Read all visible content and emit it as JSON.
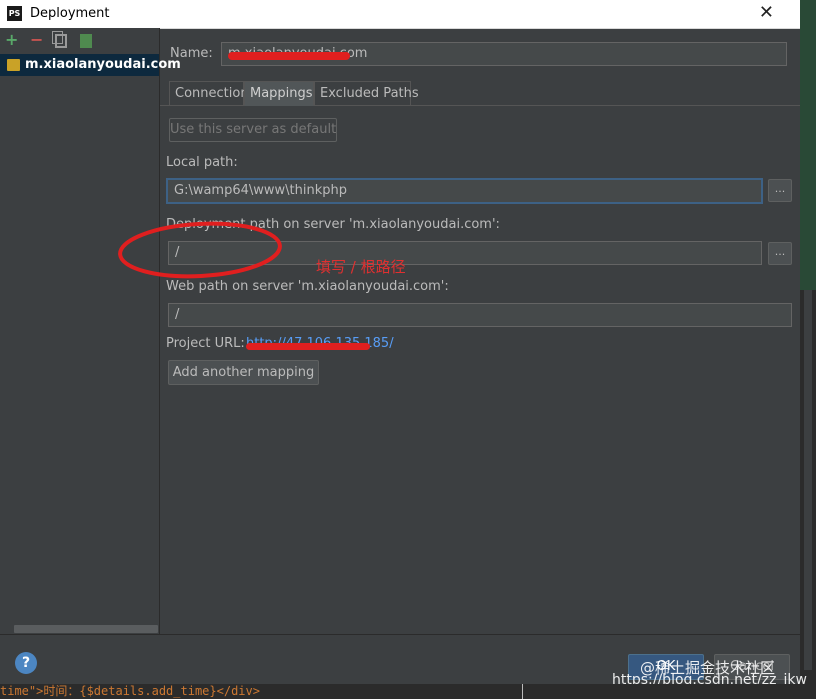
{
  "window": {
    "app_icon": "PS",
    "title": "Deployment",
    "close_glyph": "✕"
  },
  "toolbar": {
    "add_icon": "plus-icon",
    "remove_icon": "minus-icon",
    "copy_icon": "copy-icon",
    "default_icon": "use-as-default-icon",
    "add_glyph": "+",
    "remove_glyph": "−"
  },
  "servers": [
    {
      "label": "m.xiaolanyoudai.com",
      "selected": true
    }
  ],
  "form": {
    "name_label": "Name:",
    "name_value": "m.xiaolanyoudai.com",
    "tabs": [
      {
        "label": "Connection"
      },
      {
        "label": "Mappings",
        "selected": true
      },
      {
        "label": "Excluded Paths"
      }
    ],
    "use_default_label": "Use this server as default",
    "local_path_label": "Local path:",
    "local_path_value": "G:\\wamp64\\www\\thinkphp",
    "deployment_path_label": "Deployment path on server 'm.xiaolanyoudai.com':",
    "deployment_path_value": "/",
    "web_path_label": "Web path on server 'm.xiaolanyoudai.com':",
    "web_path_value": "/",
    "project_url_label": "Project URL:",
    "project_url_value": "http://47.106.135.185/",
    "add_mapping_label": "Add another mapping",
    "browse_glyph": "..."
  },
  "annotation": {
    "text": "填写 / 根路径",
    "color": "#e03030"
  },
  "footer": {
    "help_glyph": "?",
    "ok_label": "OK",
    "cancel_label": "Cancel"
  },
  "watermarks": {
    "juejin": "@稀土掘金技术社区",
    "csdn": "https://blog.csdn.net/zz_ikw"
  },
  "code_strip": {
    "text": "time\">时间：{$details.add_time}</div>"
  },
  "colors": {
    "background": "#3c3f41",
    "selection": "#0d293e",
    "accent_blue": "#365880",
    "field_bg": "#45494a"
  }
}
